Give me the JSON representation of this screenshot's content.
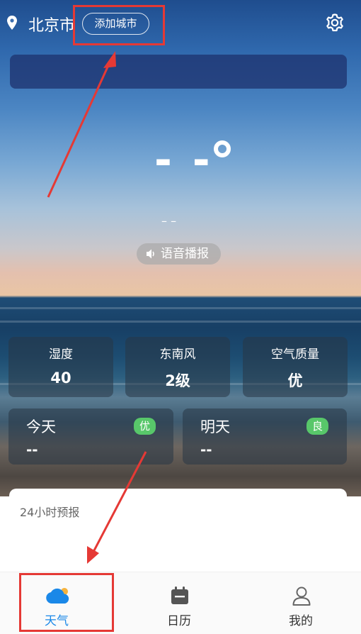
{
  "header": {
    "city": "北京市",
    "add_city_label": "添加城市",
    "icons": {
      "location": "location-pin-icon",
      "settings": "gear-icon"
    }
  },
  "current": {
    "temperature": "- -",
    "condition": "– –",
    "voice_broadcast_label": "语音播报"
  },
  "metrics": [
    {
      "label": "湿度",
      "value": "40"
    },
    {
      "label": "东南风",
      "value": "2级"
    },
    {
      "label": "空气质量",
      "value": "优"
    }
  ],
  "days": [
    {
      "label": "今天",
      "value": "--",
      "aqi": "优"
    },
    {
      "label": "明天",
      "value": "--",
      "aqi": "良"
    }
  ],
  "forecast": {
    "title": "24小时预报"
  },
  "nav": {
    "items": [
      {
        "label": "天气",
        "icon": "cloud-sun-icon",
        "active": true
      },
      {
        "label": "日历",
        "icon": "calendar-icon",
        "active": false
      },
      {
        "label": "我的",
        "icon": "person-icon",
        "active": false
      }
    ]
  },
  "colors": {
    "accent": "#1a88e8",
    "aqi_badge": "#58c76a",
    "highlight": "#e53935"
  }
}
